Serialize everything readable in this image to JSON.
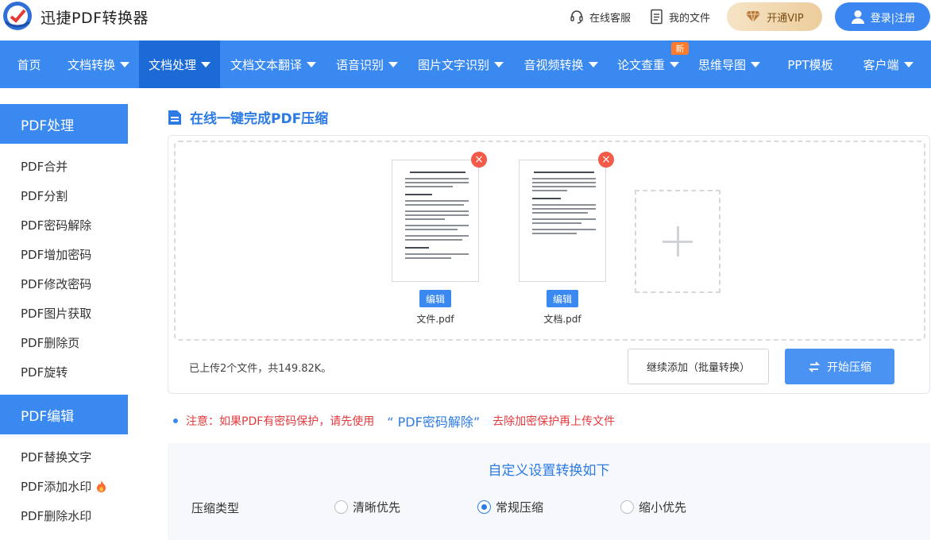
{
  "header": {
    "brand": "迅捷PDF转换器",
    "service_label": "在线客服",
    "files_label": "我的文件",
    "vip_label": "开通VIP",
    "login_label": "登录|注册"
  },
  "nav": {
    "items": [
      {
        "label": "首页",
        "dropdown": false
      },
      {
        "label": "文档转换",
        "dropdown": true
      },
      {
        "label": "文档处理",
        "dropdown": true,
        "active": true
      },
      {
        "label": "文档文本翻译",
        "dropdown": true
      },
      {
        "label": "语音识别",
        "dropdown": true
      },
      {
        "label": "图片文字识别",
        "dropdown": true
      },
      {
        "label": "音视频转换",
        "dropdown": true
      },
      {
        "label": "论文查重",
        "dropdown": true
      },
      {
        "label": "思维导图",
        "dropdown": true
      },
      {
        "label": "PPT模板",
        "dropdown": false
      },
      {
        "label": "客户端",
        "dropdown": true
      }
    ],
    "new_badge": "新"
  },
  "sidebar": {
    "sections": [
      {
        "title": "PDF处理",
        "items": [
          "PDF合并",
          "PDF分割",
          "PDF密码解除",
          "PDF增加密码",
          "PDF修改密码",
          "PDF图片获取",
          "PDF删除页",
          "PDF旋转"
        ]
      },
      {
        "title": "PDF编辑",
        "items": [
          "PDF替换文字",
          "PDF添加水印",
          "PDF删除水印"
        ]
      }
    ]
  },
  "main": {
    "title": "在线一键完成PDF压缩",
    "files": [
      {
        "name": "文件.pdf",
        "edit_label": "编辑"
      },
      {
        "name": "文档.pdf",
        "edit_label": "编辑"
      }
    ],
    "upload_status": "已上传2个文件，共149.82K。",
    "continue_label": "继续添加（批量转换）",
    "start_label": "开始压缩",
    "notice_prefix": "注意：如果PDF有密码保护，请先使用",
    "notice_link": "“ PDF密码解除”",
    "notice_suffix": "去除加密保护再上传文件",
    "settings_title": "自定义设置转换如下",
    "compress_type_label": "压缩类型",
    "compress_options": [
      "清晰优先",
      "常规压缩",
      "缩小优先"
    ],
    "compress_selected": "常规压缩"
  },
  "colors": {
    "primary": "#3a89f1",
    "active_nav": "#1c6ad6",
    "danger": "#f45a48",
    "notice": "#e4393c"
  }
}
